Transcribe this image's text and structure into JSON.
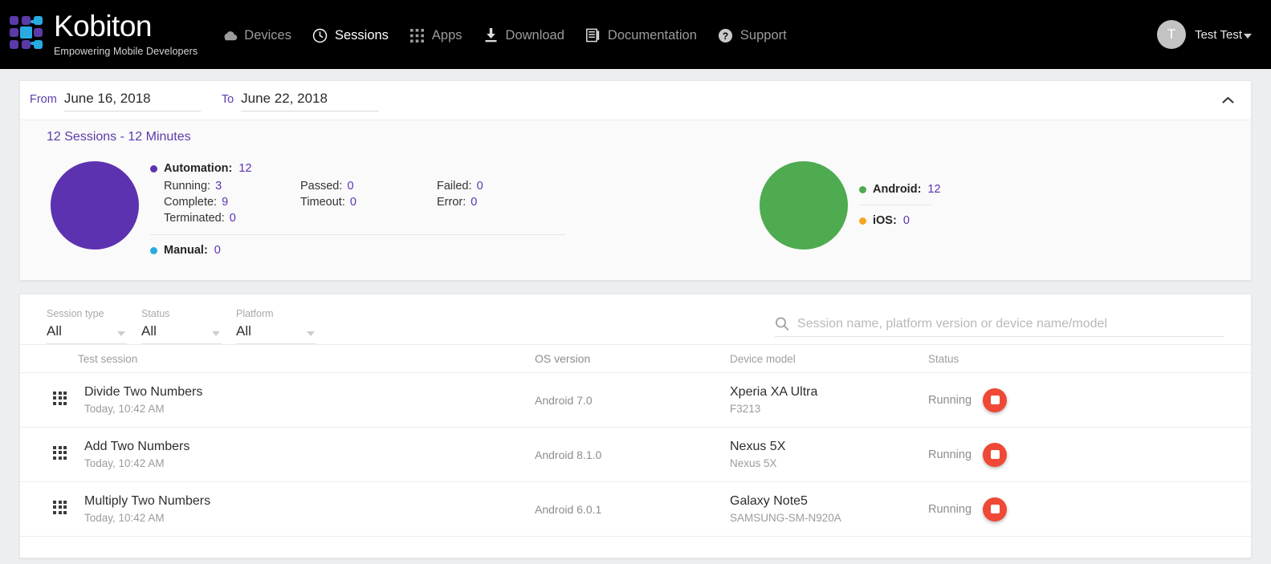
{
  "brand": {
    "name": "Kobiton",
    "tagline": "Empowering Mobile Developers",
    "logo_colors": {
      "purple": "#5b3aa8",
      "blue": "#29abe2"
    }
  },
  "nav": {
    "items": [
      {
        "label": "Devices",
        "icon": "cloud-icon",
        "active": false
      },
      {
        "label": "Sessions",
        "icon": "clock-icon",
        "active": true
      },
      {
        "label": "Apps",
        "icon": "grid-apps-icon",
        "active": false
      },
      {
        "label": "Download",
        "icon": "download-icon",
        "active": false
      },
      {
        "label": "Documentation",
        "icon": "document-icon",
        "active": false
      },
      {
        "label": "Support",
        "icon": "question-circle-icon",
        "active": false
      }
    ]
  },
  "user": {
    "initial": "T",
    "name": "Test Test"
  },
  "daterange": {
    "from_label": "From",
    "from_value": "June 16, 2018",
    "to_label": "To",
    "to_value": "June 22, 2018",
    "collapse_icon": "chevron-up-icon"
  },
  "summary": {
    "title": "12 Sessions - 12 Minutes",
    "automation": {
      "label": "Automation:",
      "value": "12",
      "color": "#5c32b0",
      "stats": [
        {
          "label": "Running:",
          "value": "3"
        },
        {
          "label": "Passed:",
          "value": "0"
        },
        {
          "label": "Failed:",
          "value": "0"
        },
        {
          "label": "Complete:",
          "value": "9"
        },
        {
          "label": "Timeout:",
          "value": "0"
        },
        {
          "label": "Error:",
          "value": "0"
        },
        {
          "label": "Terminated:",
          "value": "0"
        }
      ]
    },
    "manual": {
      "label": "Manual:",
      "value": "0",
      "color": "#29abe2"
    },
    "platforms": [
      {
        "label": "Android:",
        "value": "12",
        "color": "#4eab50"
      },
      {
        "label": "iOS:",
        "value": "0",
        "color": "#f5a623"
      }
    ]
  },
  "chart_data": [
    {
      "type": "pie",
      "title": "Session type distribution",
      "categories": [
        "Automation",
        "Manual"
      ],
      "values": [
        12,
        0
      ],
      "colors": [
        "#5c32b0",
        "#29abe2"
      ],
      "legend": "right"
    },
    {
      "type": "pie",
      "title": "Platform distribution",
      "categories": [
        "Android",
        "iOS"
      ],
      "values": [
        12,
        0
      ],
      "colors": [
        "#4eab50",
        "#f5a623"
      ],
      "legend": "right"
    }
  ],
  "filters": [
    {
      "label": "Session type",
      "value": "All"
    },
    {
      "label": "Status",
      "value": "All"
    },
    {
      "label": "Platform",
      "value": "All"
    }
  ],
  "search": {
    "icon": "search-icon",
    "placeholder": "Session name, platform version or device name/model",
    "value": ""
  },
  "table": {
    "columns": [
      "Test session",
      "OS version",
      "Device model",
      "Status"
    ],
    "rows": [
      {
        "icon": "grid-dots-icon",
        "name": "Divide Two Numbers",
        "time": "Today, 10:42 AM",
        "os": "Android 7.0",
        "device": "Xperia XA Ultra",
        "device_sub": "F3213",
        "status": "Running",
        "action_icon": "stop-button"
      },
      {
        "icon": "grid-dots-icon",
        "name": "Add Two Numbers",
        "time": "Today, 10:42 AM",
        "os": "Android 8.1.0",
        "device": "Nexus 5X",
        "device_sub": "Nexus 5X",
        "status": "Running",
        "action_icon": "stop-button"
      },
      {
        "icon": "grid-dots-icon",
        "name": "Multiply Two Numbers",
        "time": "Today, 10:42 AM",
        "os": "Android 6.0.1",
        "device": "Galaxy Note5",
        "device_sub": "SAMSUNG-SM-N920A",
        "status": "Running",
        "action_icon": "stop-button"
      }
    ]
  }
}
